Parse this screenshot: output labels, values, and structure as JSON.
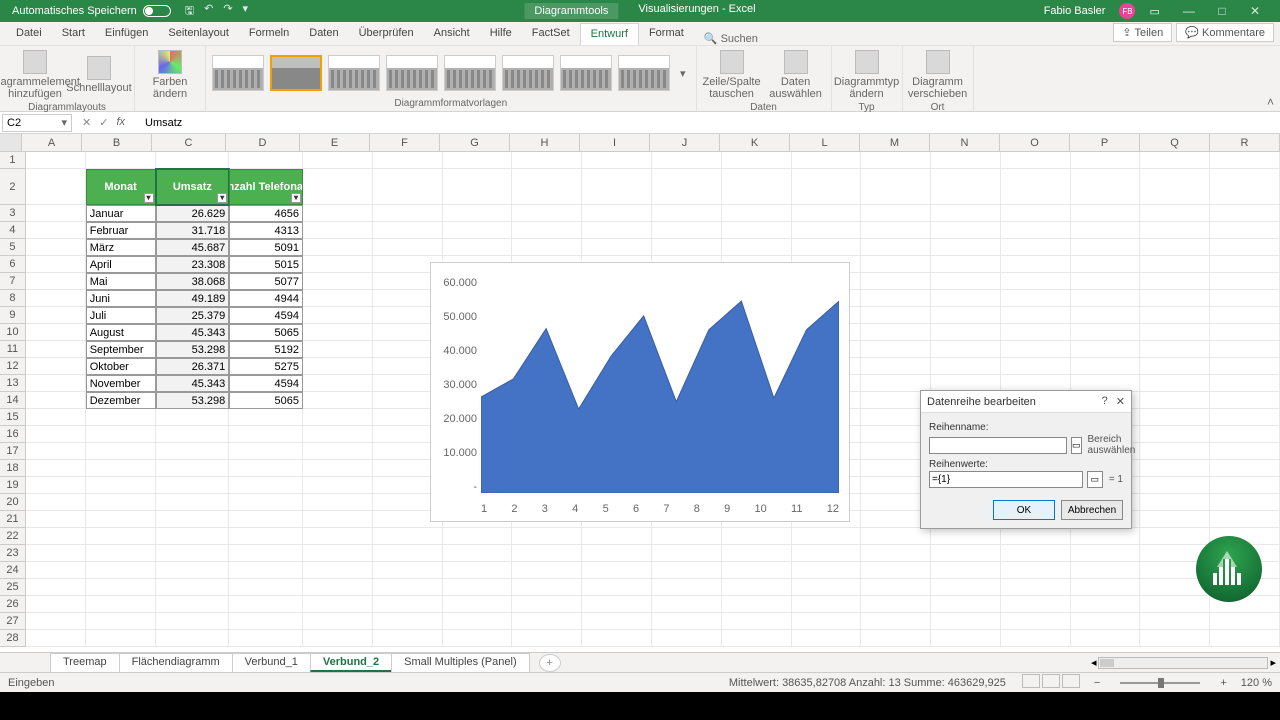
{
  "titlebar": {
    "autosave": "Automatisches Speichern",
    "tool_context": "Diagrammtools",
    "doc": "Visualisierungen - Excel",
    "user": "Fabio Basler",
    "user_initials": "FB"
  },
  "menu": {
    "tabs": [
      "Datei",
      "Start",
      "Einfügen",
      "Seitenlayout",
      "Formeln",
      "Daten",
      "Überprüfen",
      "Ansicht",
      "Hilfe",
      "FactSet",
      "Entwurf",
      "Format"
    ],
    "search": "Suchen",
    "active": "Entwurf",
    "share": "Teilen",
    "comments": "Kommentare"
  },
  "ribbon": {
    "layouts": {
      "btns": [
        "Diagrammelement hinzufügen",
        "Schnelllayout"
      ],
      "label": "Diagrammlayouts"
    },
    "colors": "Farben ändern",
    "styles_label": "Diagrammformatvorlagen",
    "data": {
      "btns": [
        "Zeile/Spalte tauschen",
        "Daten auswählen"
      ],
      "label": "Daten"
    },
    "type": {
      "btn": "Diagrammtyp ändern",
      "label": "Typ"
    },
    "loc": {
      "btn": "Diagramm verschieben",
      "label": "Ort"
    }
  },
  "fx": {
    "cell": "C2",
    "formula": "Umsatz"
  },
  "columns": [
    "A",
    "B",
    "C",
    "D",
    "E",
    "F",
    "G",
    "H",
    "I",
    "J",
    "K",
    "L",
    "M",
    "N",
    "O",
    "P",
    "Q",
    "R"
  ],
  "table": {
    "headers": [
      "Monat",
      "Umsatz",
      "Anzahl Telefonate"
    ],
    "rows": [
      {
        "m": "Januar",
        "u": "26.629",
        "t": "4656"
      },
      {
        "m": "Februar",
        "u": "31.718",
        "t": "4313"
      },
      {
        "m": "März",
        "u": "45.687",
        "t": "5091"
      },
      {
        "m": "April",
        "u": "23.308",
        "t": "5015"
      },
      {
        "m": "Mai",
        "u": "38.068",
        "t": "5077"
      },
      {
        "m": "Juni",
        "u": "49.189",
        "t": "4944"
      },
      {
        "m": "Juli",
        "u": "25.379",
        "t": "4594"
      },
      {
        "m": "August",
        "u": "45.343",
        "t": "5065"
      },
      {
        "m": "September",
        "u": "53.298",
        "t": "5192"
      },
      {
        "m": "Oktober",
        "u": "26.371",
        "t": "5275"
      },
      {
        "m": "November",
        "u": "45.343",
        "t": "4594"
      },
      {
        "m": "Dezember",
        "u": "53.298",
        "t": "5065"
      }
    ]
  },
  "chart_data": {
    "type": "area",
    "x": [
      1,
      2,
      3,
      4,
      5,
      6,
      7,
      8,
      9,
      10,
      11,
      12
    ],
    "values": [
      26629,
      31718,
      45687,
      23308,
      38068,
      49189,
      25379,
      45343,
      53298,
      26371,
      45343,
      53298
    ],
    "ylim": [
      0,
      60000
    ],
    "yticks": [
      "60.000",
      "50.000",
      "40.000",
      "30.000",
      "20.000",
      "10.000",
      "-"
    ],
    "xticks": [
      "1",
      "2",
      "3",
      "4",
      "5",
      "6",
      "7",
      "8",
      "9",
      "10",
      "11",
      "12"
    ]
  },
  "dialog": {
    "title": "Datenreihe bearbeiten",
    "name_label": "Reihenname:",
    "name_value": "",
    "name_hint": "Bereich auswählen",
    "values_label": "Reihenwerte:",
    "values_value": "={1}",
    "values_hint": "= 1",
    "ok": "OK",
    "cancel": "Abbrechen"
  },
  "sheets": {
    "tabs": [
      "Treemap",
      "Flächendiagramm",
      "Verbund_1",
      "Verbund_2",
      "Small Multiples (Panel)"
    ],
    "active": "Verbund_2"
  },
  "status": {
    "mode": "Eingeben",
    "stats": "Mittelwert: 38635,82708    Anzahl: 13    Summe: 463629,925",
    "zoom": "120 %"
  }
}
